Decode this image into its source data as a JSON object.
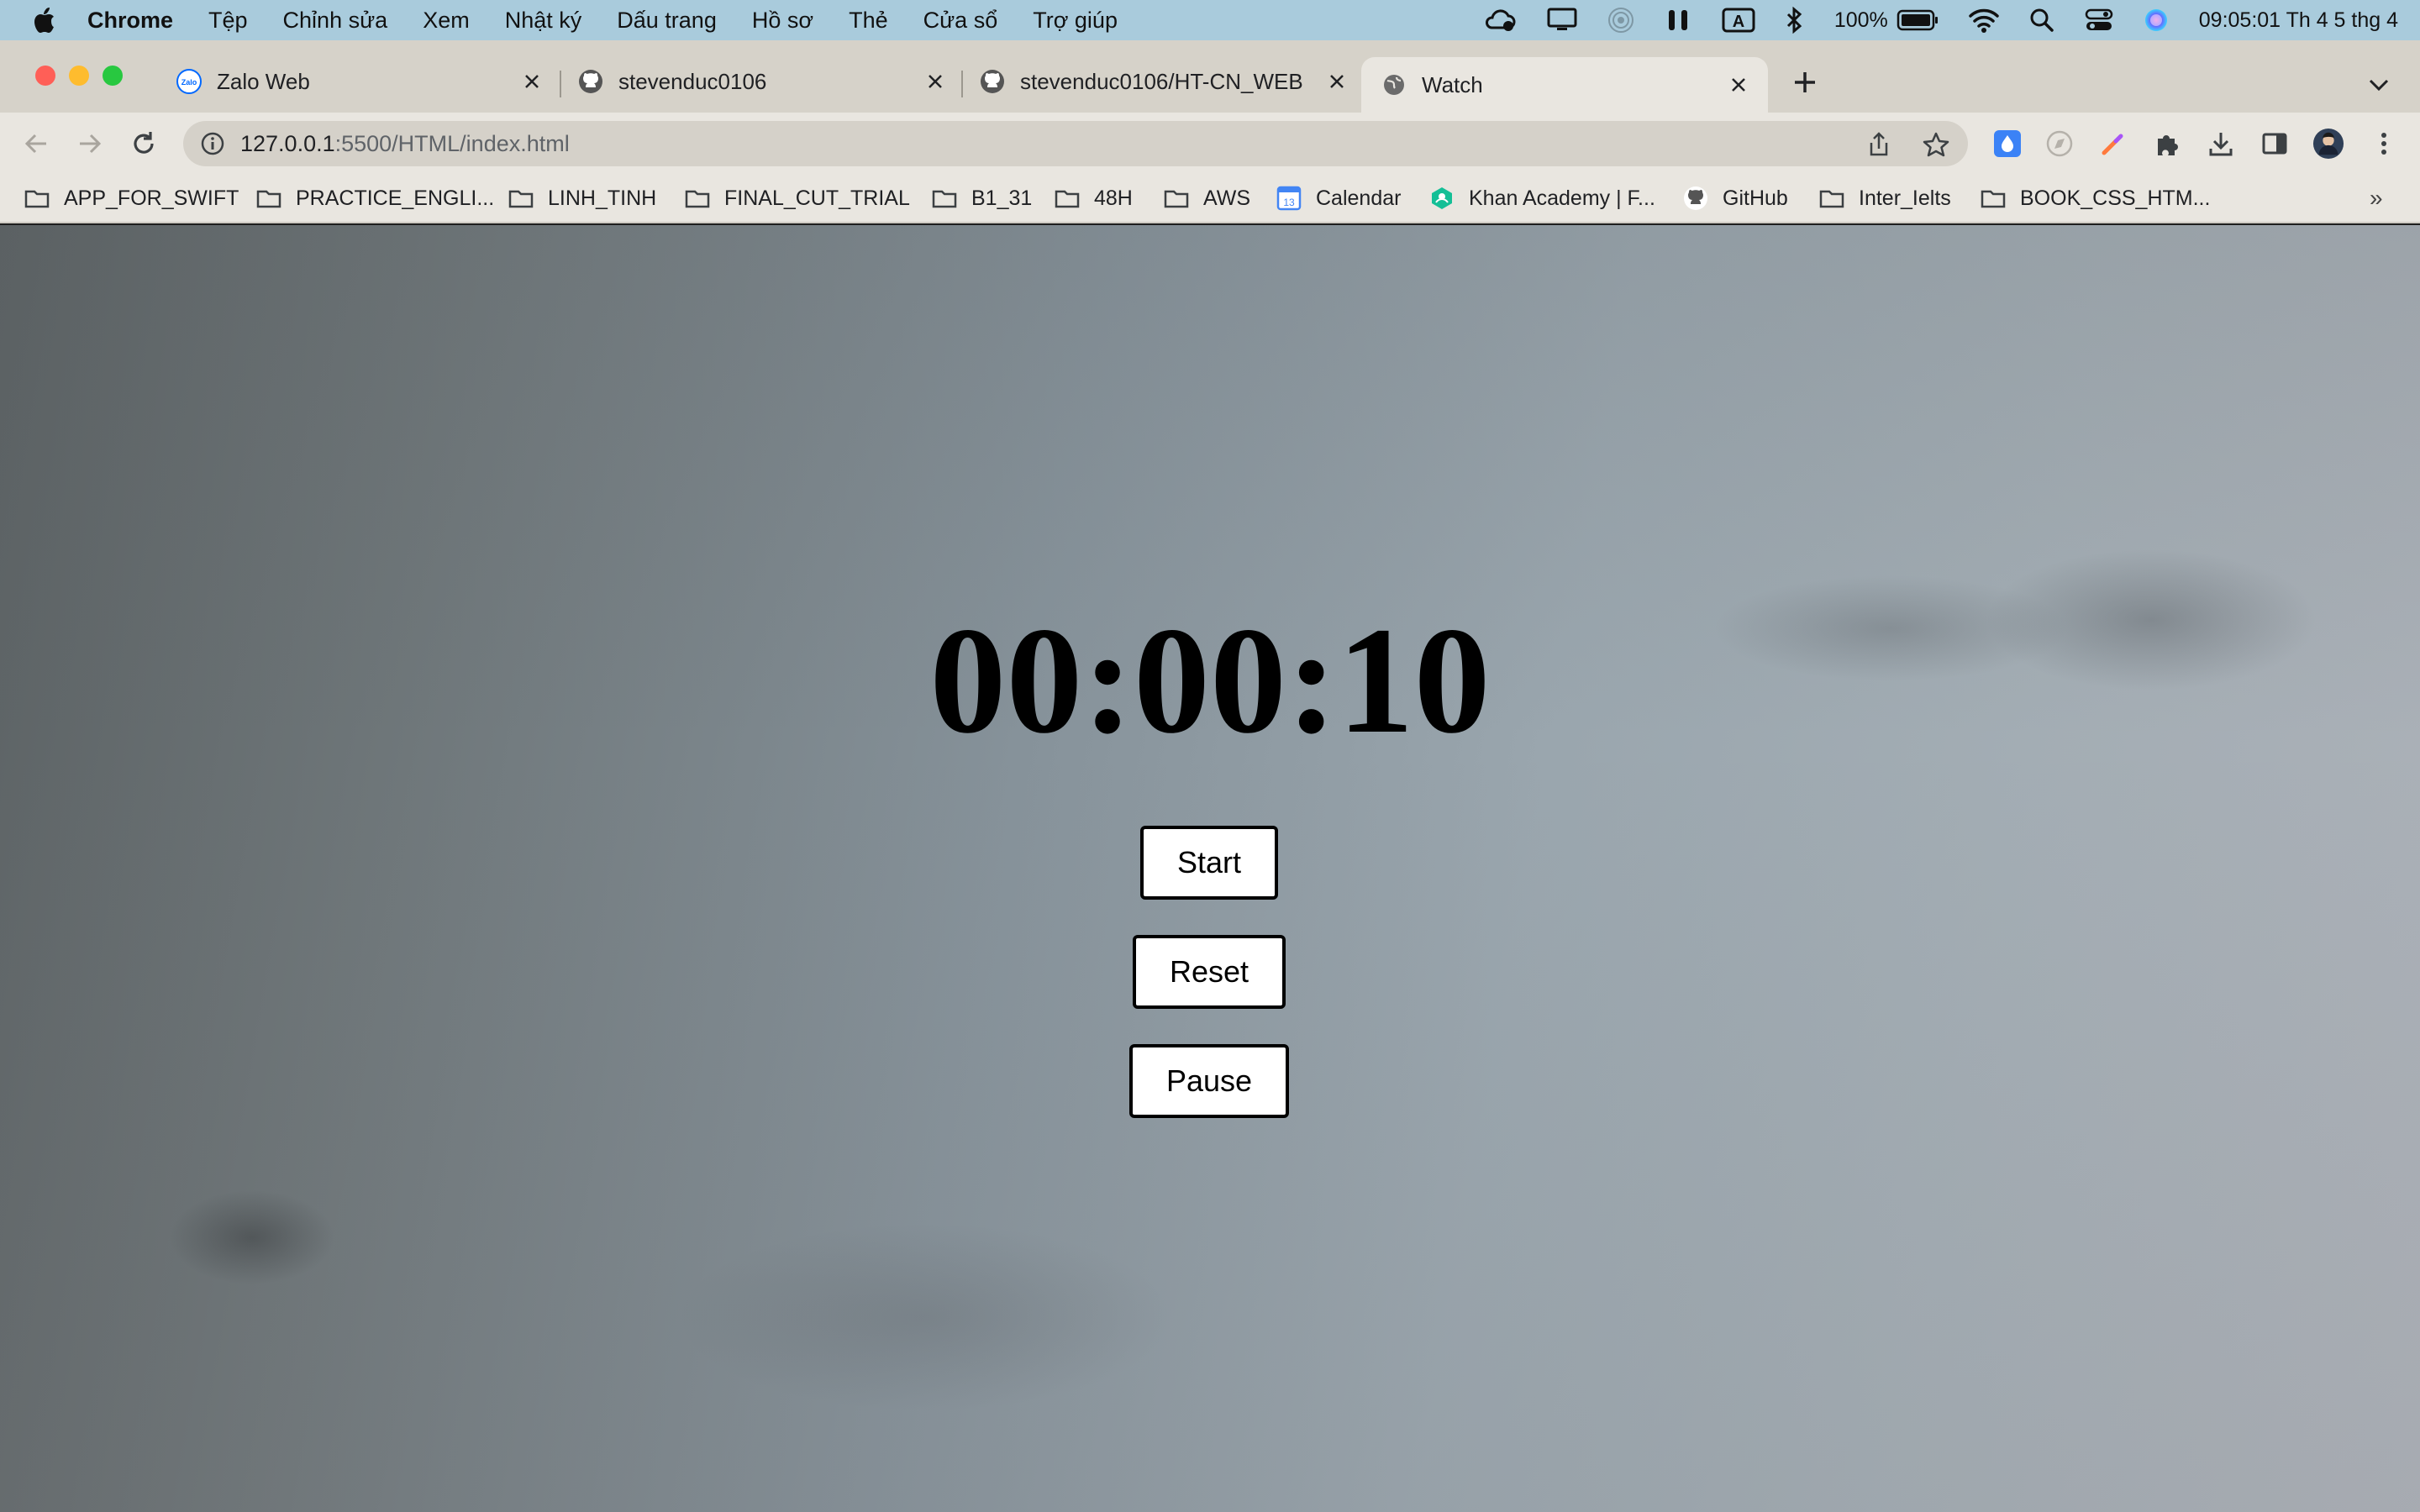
{
  "menubar": {
    "app": "Chrome",
    "items": [
      "Tệp",
      "Chỉnh sửa",
      "Xem",
      "Nhật ký",
      "Dấu trang",
      "Hồ sơ",
      "Thẻ",
      "Cửa sổ",
      "Trợ giúp"
    ],
    "battery": "100%",
    "clock": "09:05:01 Th 4 5 thg 4",
    "input_source": "A"
  },
  "tabs": [
    {
      "title": "Zalo Web",
      "icon": "zalo-icon",
      "active": false
    },
    {
      "title": "stevenduc0106",
      "icon": "github-icon",
      "active": false
    },
    {
      "title": "stevenduc0106/HT-CN_WEB",
      "icon": "github-icon",
      "active": false
    },
    {
      "title": "Watch",
      "icon": "globe-icon",
      "active": true
    }
  ],
  "toolbar": {
    "url_host": "127.0.0.1",
    "url_rest": ":5500/HTML/index.html"
  },
  "bookmarks": [
    {
      "label": "APP_FOR_SWIFT",
      "icon": "folder-icon"
    },
    {
      "label": "PRACTICE_ENGLI...",
      "icon": "folder-icon"
    },
    {
      "label": "LINH_TINH",
      "icon": "folder-icon"
    },
    {
      "label": "FINAL_CUT_TRIAL",
      "icon": "folder-icon"
    },
    {
      "label": "B1_31",
      "icon": "folder-icon"
    },
    {
      "label": "48H",
      "icon": "folder-icon"
    },
    {
      "label": "AWS",
      "icon": "folder-icon"
    },
    {
      "label": "Calendar",
      "icon": "calendar-icon"
    },
    {
      "label": "Khan Academy | F...",
      "icon": "khan-academy-icon"
    },
    {
      "label": "GitHub",
      "icon": "github-icon"
    },
    {
      "label": "Inter_Ielts",
      "icon": "folder-icon"
    },
    {
      "label": "BOOK_CSS_HTM...",
      "icon": "folder-icon"
    }
  ],
  "stopwatch": {
    "time": "00:00:10",
    "buttons": {
      "start": "Start",
      "reset": "Reset",
      "pause": "Pause"
    }
  },
  "colors": {
    "menubar": "#a9cbdc",
    "tabstrip": "#d6d2c9",
    "toolbar": "#e9e6e0",
    "close": "#ff5f57",
    "minimize": "#febc2e",
    "zoom": "#28c840"
  }
}
